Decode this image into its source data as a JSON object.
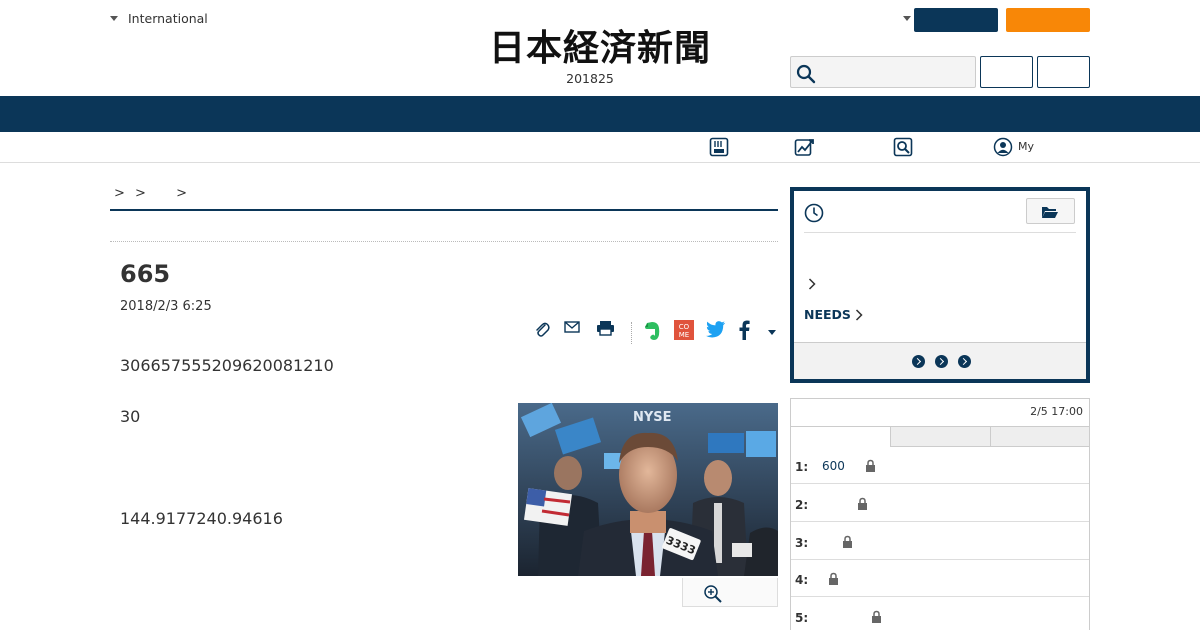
{
  "header": {
    "edition_label": "International",
    "logo_text": "日本経済新聞",
    "date_text": "201825",
    "search_placeholder": ""
  },
  "subnav": {
    "my_label": "My"
  },
  "breadcrumb": {
    "sep1": ">",
    "sep2": ">",
    "sep3": ">"
  },
  "article": {
    "title": "665",
    "date": "2018/2/3 6:25",
    "paragraphs": [
      "30665755520962008121​0",
      "30",
      "144.9177240.94616"
    ],
    "photo_labels": {
      "exchange_sign": "NYSE",
      "badge": "3333"
    }
  },
  "history_box": {
    "needs_label": "NEEDS"
  },
  "ranking": {
    "timestamp": "2/5 17:00",
    "rows": [
      {
        "rank": "1:",
        "value": "600"
      },
      {
        "rank": "2:",
        "value": ""
      },
      {
        "rank": "3:",
        "value": ""
      },
      {
        "rank": "4:",
        "value": ""
      },
      {
        "rank": "5:",
        "value": ""
      }
    ]
  },
  "colors": {
    "navy": "#0b3658",
    "orange": "#f88707"
  }
}
